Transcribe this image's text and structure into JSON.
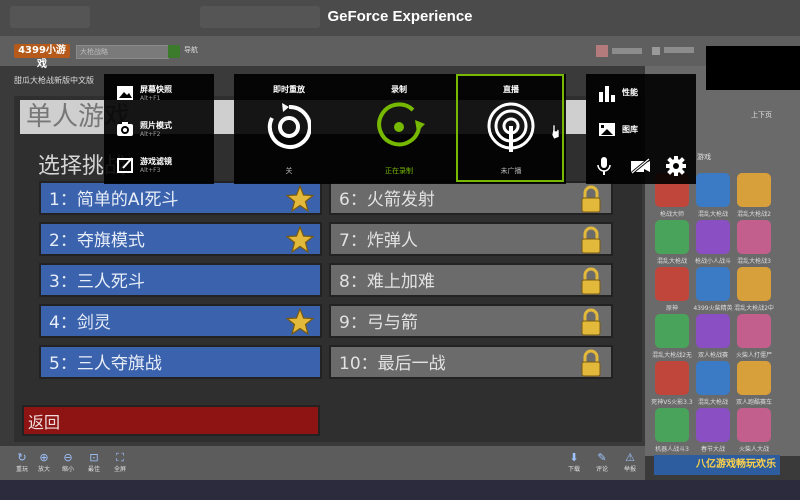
{
  "overlay": {
    "title": "GeForce Experience",
    "left_panel": [
      {
        "label": "屏幕快照",
        "shortcut": "Alt+F1"
      },
      {
        "label": "照片模式",
        "shortcut": "Alt+F2"
      },
      {
        "label": "游戏滤镜",
        "shortcut": "Alt+F3"
      }
    ],
    "instant_replay": {
      "label": "即时重放",
      "status": "关"
    },
    "record": {
      "label": "录制",
      "status": "正在录制"
    },
    "broadcast": {
      "label": "直播",
      "status": "未广播"
    },
    "right_panel": {
      "performance": "性能",
      "gallery": "图库"
    },
    "colors": {
      "accent": "#76b900",
      "panel": "#0d0d0d"
    }
  },
  "site": {
    "logo": "4399小游戏",
    "search_placeholder": "大枪战略",
    "nav": "导航",
    "breadcrumb": "甜瓜大枪战新版中文版"
  },
  "game": {
    "title": "单人游戏",
    "subtitle": "选择挑战",
    "levels_left": [
      {
        "text": "1：简单的AI死斗",
        "icon": "star-icon"
      },
      {
        "text": "2：夺旗模式",
        "icon": "star-icon"
      },
      {
        "text": "3：三人死斗",
        "icon": ""
      },
      {
        "text": "4：剑灵",
        "icon": "star-icon"
      },
      {
        "text": "5：三人夺旗战",
        "icon": ""
      }
    ],
    "levels_right": [
      {
        "text": "6：火箭发射",
        "icon": "lock-icon"
      },
      {
        "text": "7：炸弹人",
        "icon": "lock-icon"
      },
      {
        "text": "8：难上加难",
        "icon": "lock-icon"
      },
      {
        "text": "9：弓与箭",
        "icon": "lock-icon"
      },
      {
        "text": "10：最后一战",
        "icon": "lock-icon"
      }
    ],
    "back": "返回"
  },
  "sidebar": {
    "paging": "上下页",
    "section": "游戏",
    "games": [
      "枪战大师",
      "混乱大枪战",
      "混乱大枪战2",
      "混乱大枪战",
      "枪战小人战斗",
      "混乱大枪战3",
      "原神",
      "4399火柴精英",
      "混乱大枪战2中",
      "混乱大枪战2无",
      "双人枪战赛",
      "火柴人打僵尸",
      "死神VS火影3.3",
      "混乱大枪战",
      "双人跑酷赛车",
      "机器人战斗3",
      "春节大战",
      "火柴人大战"
    ],
    "banner": "八亿游戏畅玩欢乐"
  },
  "toolbar": [
    {
      "label": "重玩",
      "icon": "replay-icon"
    },
    {
      "label": "放大",
      "icon": "zoom-in-icon"
    },
    {
      "label": "缩小",
      "icon": "zoom-out-icon"
    },
    {
      "label": "最佳",
      "icon": "fit-icon"
    },
    {
      "label": "全屏",
      "icon": "fullscreen-icon"
    },
    {
      "label": "下载",
      "icon": "download-icon"
    },
    {
      "label": "评论",
      "icon": "comment-icon"
    },
    {
      "label": "举报",
      "icon": "report-icon"
    }
  ]
}
